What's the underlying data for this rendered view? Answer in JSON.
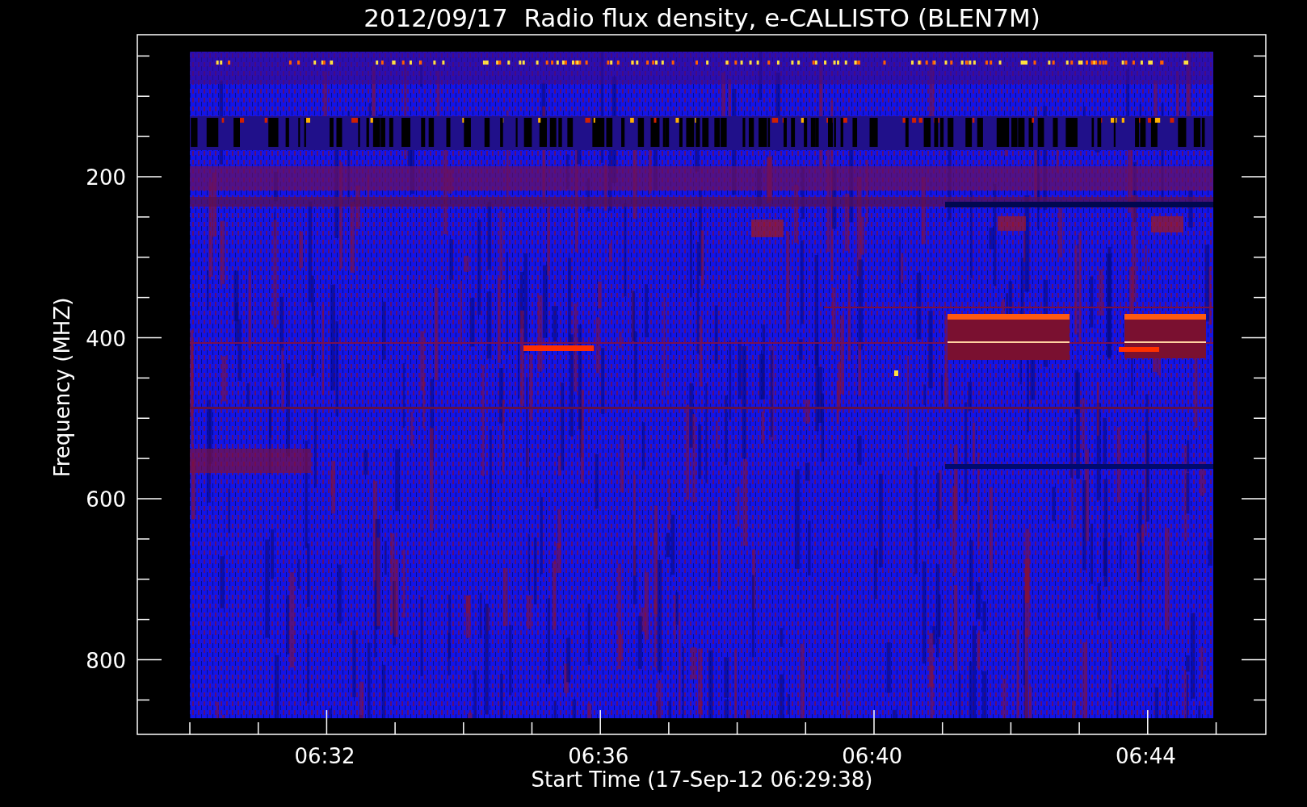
{
  "title": "2012/09/17  Radio flux density, e-CALLISTO (BLEN7M)",
  "plot": {
    "kind": "spectrogram",
    "ylabel": "Frequency (MHZ)",
    "xlabel": "Start Time (17-Sep-12 06:29:38)",
    "yticks": [
      "200",
      "400",
      "600",
      "800"
    ],
    "xticks": [
      "06:32",
      "06:36",
      "06:40",
      "06:44"
    ]
  }
}
